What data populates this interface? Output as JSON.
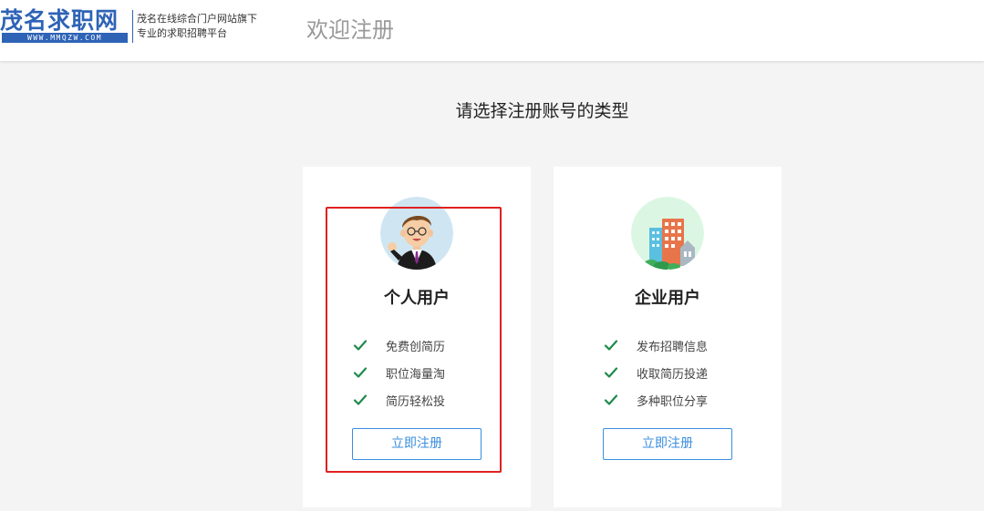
{
  "header": {
    "logo_title": "茂名求职网",
    "logo_url": "WWW.MMQZW.COM",
    "slogan_line1": "茂名在线综合门户网站旗下",
    "slogan_line2": "专业的求职招聘平台",
    "page_title": "欢迎注册"
  },
  "main": {
    "subtitle": "请选择注册账号的类型"
  },
  "cards": [
    {
      "title": "个人用户",
      "icon": "person-avatar-icon",
      "features": [
        "免费创简历",
        "职位海量淘",
        "简历轻松投"
      ],
      "button_label": "立即注册"
    },
    {
      "title": "企业用户",
      "icon": "company-building-icon",
      "features": [
        "发布招聘信息",
        "收取简历投递",
        "多种职位分享"
      ],
      "button_label": "立即注册"
    }
  ],
  "colors": {
    "brand": "#2e63b6",
    "accent": "#3a8dde",
    "check": "#1e8a4a",
    "highlight": "#e02020"
  }
}
